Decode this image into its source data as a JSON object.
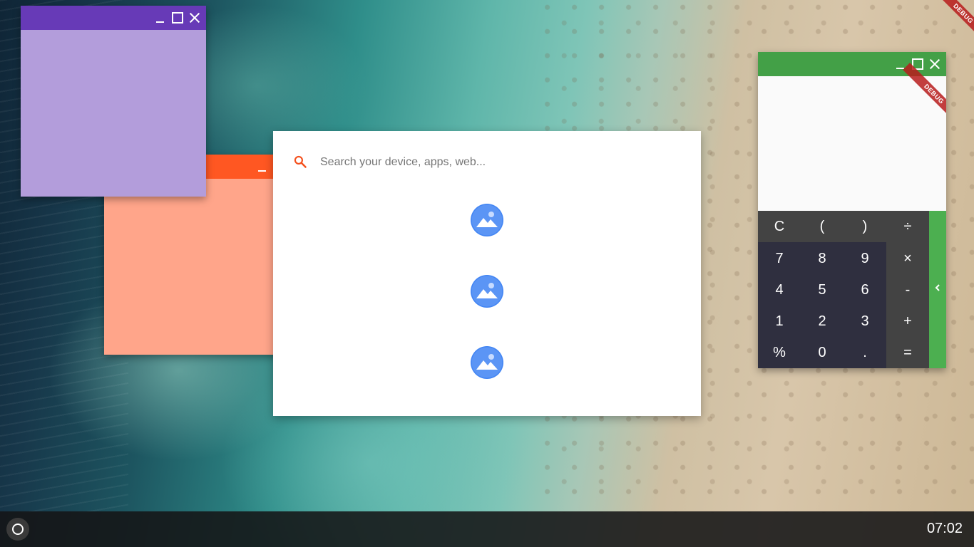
{
  "launcher": {
    "search_placeholder": "Search your device, apps, web...",
    "search_value": "",
    "results": [
      {
        "icon": "photos-app-icon"
      },
      {
        "icon": "photos-app-icon"
      },
      {
        "icon": "photos-app-icon"
      }
    ]
  },
  "windows": {
    "purple": {
      "titlebar_color": "#673ab7",
      "body_color": "#b39ddb"
    },
    "orange": {
      "titlebar_color": "#ff5722",
      "body_color": "#ffa58a"
    },
    "calculator": {
      "titlebar_color": "#43a047",
      "debug_label": "DEBUG"
    }
  },
  "calculator": {
    "keys": [
      [
        "C",
        "(",
        ")",
        "÷"
      ],
      [
        "7",
        "8",
        "9",
        "×"
      ],
      [
        "4",
        "5",
        "6",
        "-"
      ],
      [
        "1",
        "2",
        "3",
        "+"
      ],
      [
        "%",
        "0",
        ".",
        "="
      ]
    ],
    "drawer_icon": "chevron-left-icon"
  },
  "screen_debug_label": "DEBUG",
  "taskbar": {
    "clock": "07:02",
    "launcher_icon": "circle-launcher-icon"
  }
}
